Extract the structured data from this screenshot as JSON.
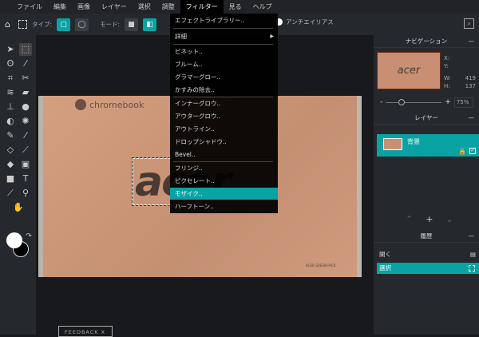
{
  "menubar": {
    "items": [
      "ファイル",
      "編集",
      "画像",
      "レイヤー",
      "選択",
      "調整",
      "フィルター",
      "見る",
      "ヘルプ"
    ],
    "active": "フィルター"
  },
  "toolbar": {
    "type_label": "タイプ:",
    "mode_label": "モード:",
    "antialias_label": "アンチエイリアス"
  },
  "filter_menu": {
    "items": [
      "エフェクトライブラリー..",
      "詳細",
      "ビネット..",
      "ブルーム..",
      "グラマーグロー..",
      "かすみの除去..",
      "インナーグロウ..",
      "アウターグロウ..",
      "アウトライン..",
      "ドロップシャドウ..",
      "Bevel..",
      "フリンジ..",
      "ピクセレート..",
      "モザイク..",
      "ハーフトーン.."
    ],
    "highlighted": "モザイク.."
  },
  "canvas": {
    "brand_text": "chromebook",
    "logo_text": "acer",
    "pack_text": "ACER GREEN PACK"
  },
  "feedback": "FEEDBACK   X",
  "navigator": {
    "title": "ナビゲーション",
    "thumb_text": "acer",
    "x_label": "X:",
    "y_label": "Y:",
    "w_label": "W:",
    "h_label": "H:",
    "w": "419",
    "h": "137",
    "zoom": "75%",
    "zoom_fraction": 0.2
  },
  "layers": {
    "title": "レイヤー",
    "items": [
      {
        "name": "背景"
      }
    ]
  },
  "history": {
    "title": "履歴",
    "items": [
      "開く",
      "選択"
    ]
  },
  "colors": {
    "accent": "#0aa3a3",
    "foreground": "#ffffff",
    "background": "#000000"
  }
}
